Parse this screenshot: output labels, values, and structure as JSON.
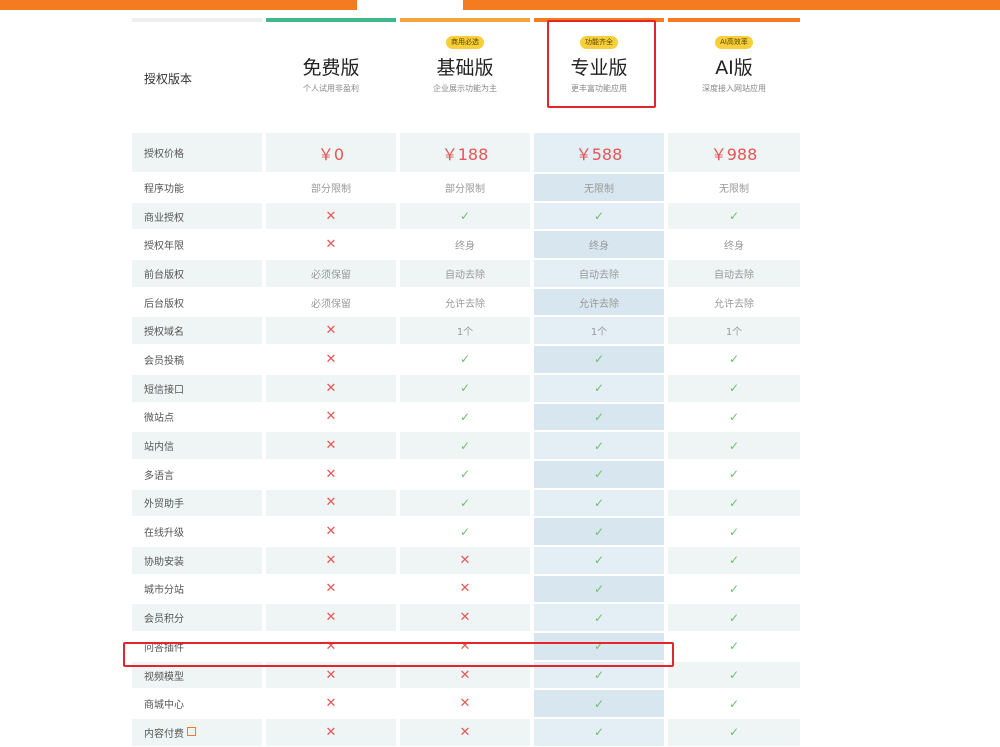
{
  "header": {
    "label": "授权版本",
    "plans": [
      {
        "name": "免费版",
        "desc": "个人试用非盈利",
        "badge": "",
        "bar_color": "#3fb88e",
        "price": "￥0"
      },
      {
        "name": "基础版",
        "desc": "企业展示功能为主",
        "badge": "商用必选",
        "bar_color": "#f4a43a",
        "price": "￥188"
      },
      {
        "name": "专业版",
        "desc": "更丰富功能应用",
        "badge": "功能齐全",
        "bar_color": "#f47b20",
        "price": "￥588"
      },
      {
        "name": "AI版",
        "desc": "深度接入网站应用",
        "badge": "AI高效率",
        "bar_color": "#f47b20",
        "price": "￥988"
      }
    ]
  },
  "price_row": {
    "label": "授权价格"
  },
  "rows": [
    {
      "label": "程序功能",
      "values": [
        "部分限制",
        "部分限制",
        "无限制",
        "无限制"
      ]
    },
    {
      "label": "商业授权",
      "values": [
        "x",
        "c",
        "c",
        "c"
      ]
    },
    {
      "label": "授权年限",
      "values": [
        "x",
        "终身",
        "终身",
        "终身"
      ]
    },
    {
      "label": "前台版权",
      "values": [
        "必须保留",
        "自动去除",
        "自动去除",
        "自动去除"
      ]
    },
    {
      "label": "后台版权",
      "values": [
        "必须保留",
        "允许去除",
        "允许去除",
        "允许去除"
      ]
    },
    {
      "label": "授权域名",
      "values": [
        "x",
        "1个",
        "1个",
        "1个"
      ]
    },
    {
      "label": "会员投稿",
      "values": [
        "x",
        "c",
        "c",
        "c"
      ]
    },
    {
      "label": "短信接口",
      "values": [
        "x",
        "c",
        "c",
        "c"
      ]
    },
    {
      "label": "微站点",
      "values": [
        "x",
        "c",
        "c",
        "c"
      ]
    },
    {
      "label": "站内信",
      "values": [
        "x",
        "c",
        "c",
        "c"
      ]
    },
    {
      "label": "多语言",
      "values": [
        "x",
        "c",
        "c",
        "c"
      ]
    },
    {
      "label": "外贸助手",
      "values": [
        "x",
        "c",
        "c",
        "c"
      ]
    },
    {
      "label": "在线升级",
      "values": [
        "x",
        "c",
        "c",
        "c"
      ]
    },
    {
      "label": "协助安装",
      "values": [
        "x",
        "x",
        "c",
        "c"
      ]
    },
    {
      "label": "城市分站",
      "values": [
        "x",
        "x",
        "c",
        "c"
      ]
    },
    {
      "label": "会员积分",
      "values": [
        "x",
        "x",
        "c",
        "c"
      ]
    },
    {
      "label": "问答插件",
      "values": [
        "x",
        "x",
        "c",
        "c"
      ]
    },
    {
      "label": "视频模型",
      "values": [
        "x",
        "x",
        "c",
        "c"
      ]
    },
    {
      "label": "商城中心",
      "values": [
        "x",
        "x",
        "c",
        "c"
      ]
    },
    {
      "label": "内容付费",
      "values": [
        "x",
        "x",
        "c",
        "c"
      ],
      "ext_icon": "external-link-icon"
    }
  ],
  "marks": {
    "cross": "✕",
    "check": "✓"
  },
  "colors": {
    "accent": "#f47b20",
    "highlight_box": "#e2262b",
    "cross": "#e55656",
    "check": "#6cc16c"
  }
}
